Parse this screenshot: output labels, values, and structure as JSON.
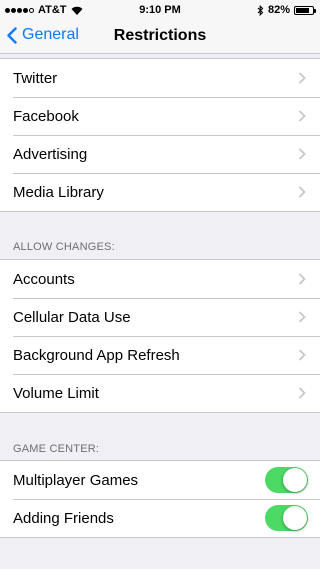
{
  "status_bar": {
    "carrier": "AT&T",
    "time": "9:10 PM",
    "battery": "82%"
  },
  "nav": {
    "back_label": "General",
    "title": "Restrictions"
  },
  "group1": {
    "items": [
      {
        "label": "Twitter"
      },
      {
        "label": "Facebook"
      },
      {
        "label": "Advertising"
      },
      {
        "label": "Media Library"
      }
    ]
  },
  "allow_changes": {
    "header": "ALLOW CHANGES:",
    "items": [
      {
        "label": "Accounts"
      },
      {
        "label": "Cellular Data Use"
      },
      {
        "label": "Background App Refresh"
      },
      {
        "label": "Volume Limit"
      }
    ]
  },
  "game_center": {
    "header": "GAME CENTER:",
    "items": [
      {
        "label": "Multiplayer Games",
        "on": true
      },
      {
        "label": "Adding Friends",
        "on": true
      }
    ]
  },
  "colors": {
    "accent": "#0a7aff",
    "toggle_on": "#4cd964",
    "background": "#efeff4"
  }
}
